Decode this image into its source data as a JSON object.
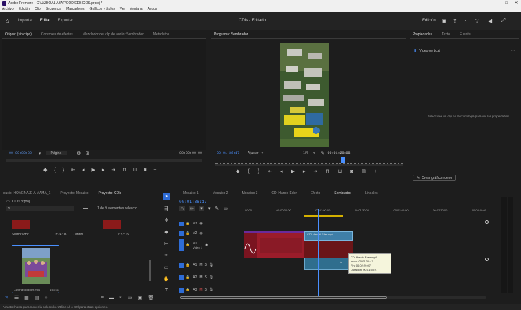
{
  "window": {
    "title": "Adobe Premiere - C:\\U\\ZBOAL ABAF\\COD\\EDBICOS.prproj *",
    "controls": [
      "–",
      "□",
      "✕"
    ]
  },
  "menu": [
    "Archivo",
    "Edición",
    "Clip",
    "Secuencia",
    "Marcadores",
    "Gráficos y títulos",
    "Ver",
    "Ventana",
    "Ayuda"
  ],
  "workspace": {
    "tabs": [
      "Importar",
      "Editar",
      "Exportar"
    ],
    "active_tab": "Editar",
    "center_title": "CDIs - Editado",
    "right_label": "Edición"
  },
  "source_panel": {
    "tabs": [
      "Origen: (sin clips)",
      "Controles de efectos",
      "Mezclador del clip de audio: Sembrador",
      "Metadatos"
    ],
    "timecode_left": "00:00:00:00",
    "fit": "Página",
    "timecode_right": "00:00:00:00"
  },
  "program_panel": {
    "tab": "Programa: Sembrador",
    "timecode": "00:01:36:17",
    "fit": "Ajustar",
    "quality": "1/4",
    "duration": "00:01:29:08"
  },
  "properties_panel": {
    "tabs": [
      "Propiedades",
      "Texto",
      "Fuente"
    ],
    "item": "Vídeo vertical",
    "message": "Seleccione un clip en la cronología para ver las propiedades.",
    "button": "Crear gráfico nuevo"
  },
  "project_panel": {
    "tabs": [
      "sucio: HOMENAJE A MAMA_1",
      "Proyecto: Mosaico",
      "Proyecto: CDIs"
    ],
    "path": "CDIs.prproj",
    "count": "1 de 9 elementos seleccio...",
    "items": [
      {
        "name": "Sembrador",
        "duration": "3:24:06",
        "extra": "Jardín"
      },
      {
        "name": "",
        "duration": "1:23:15",
        "extra": ""
      },
      {
        "name": "CDI Harold Eder.mp4",
        "duration": "1:53:11",
        "extra": ""
      }
    ]
  },
  "timeline": {
    "tabs": [
      "Mosaico 1",
      "Mosaico 2",
      "Mosaico 3",
      "CDI Harold Eder",
      "Efecto",
      "Sembrador",
      "Lineales"
    ],
    "active_tab": "Sembrador",
    "timecode": "00:01:36:17",
    "ruler": [
      "00:00",
      "00:00:30:00",
      "00:01:00:00",
      "00:01:30:00",
      "00:02:00:00",
      "00:02:30:00",
      "00:03:00:00"
    ],
    "tracks_video": [
      "V3",
      "V2",
      "V1"
    ],
    "tracks_audio": [
      "A1",
      "A2",
      "A3"
    ],
    "track_name": "Vídeo 1",
    "clip_title": "CDI Harold Eder.mp4",
    "tooltip": {
      "name": "CDI Harold Eder.mp4",
      "start": "Inicio: 00:01:36:47",
      "end": "Fin: 00:02:29:07",
      "duration": "Duración: 00:01:55:27"
    },
    "v2_label": "fx"
  },
  "status_bar": "Arrastre hasta para mover la selección. Utilice Alt o Ctrl para otras opciones."
}
